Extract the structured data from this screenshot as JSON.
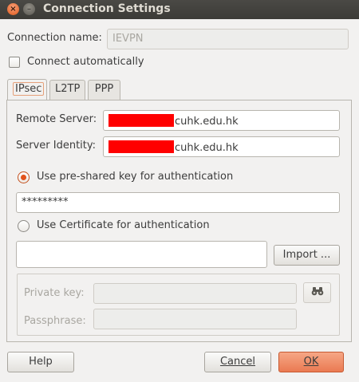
{
  "window": {
    "title": "Connection Settings",
    "close_glyph": "×",
    "minimize_glyph": "–"
  },
  "connection_name": {
    "label": "Connection name:",
    "value": "IEVPN"
  },
  "connect_automatically": {
    "label": "Connect automatically",
    "checked": false
  },
  "tabs": [
    {
      "label": "IPsec",
      "active": true
    },
    {
      "label": "L2TP",
      "active": false
    },
    {
      "label": "PPP",
      "active": false
    }
  ],
  "ipsec": {
    "remote_server": {
      "label": "Remote Server:",
      "value": "cuhk.edu.hk"
    },
    "server_identity": {
      "label": "Server Identity:",
      "value": "cuhk.edu.hk"
    },
    "psk_option": {
      "label": "Use pre-shared key for authentication",
      "selected": true
    },
    "psk_value": "*********",
    "cert_option": {
      "label": "Use Certificate for authentication",
      "selected": false
    },
    "import_button": "Import ...",
    "private_key": {
      "label": "Private key:",
      "value": ""
    },
    "passphrase": {
      "label": "Passphrase:",
      "value": ""
    },
    "key_browse_icon": "binoculars-icon"
  },
  "footer": {
    "help": "Help",
    "cancel": "Cancel",
    "ok": "OK"
  },
  "colors": {
    "accent": "#e2531c",
    "titlebar": "#3c3b37",
    "redaction": "#ff0000"
  }
}
